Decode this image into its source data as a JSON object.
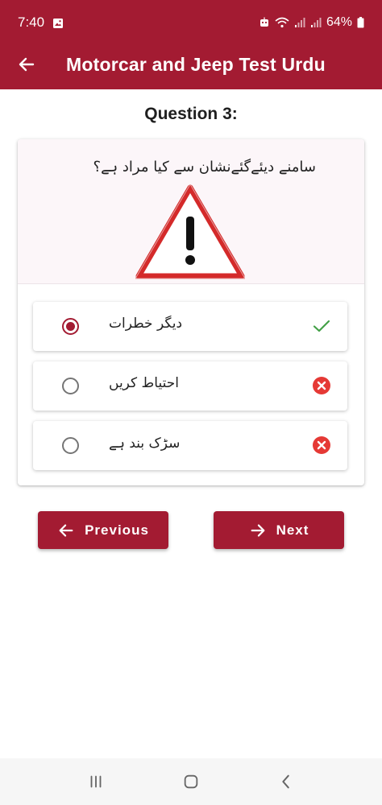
{
  "status_bar": {
    "time": "7:40",
    "battery": "64%",
    "icons": [
      "image-icon",
      "robot-icon",
      "wifi-icon",
      "signal-icon",
      "signal-icon",
      "battery-icon"
    ]
  },
  "app_bar": {
    "title": "Motorcar and Jeep Test Urdu",
    "back_icon": "arrow-left-icon"
  },
  "question": {
    "number_label": "Question 3:",
    "text": "سامنے دیئےگئےنشان سے کیا مراد ہے؟",
    "image": "warning-triangle-sign"
  },
  "options": [
    {
      "label": "دیگر خطرات",
      "selected": true,
      "result": "correct",
      "icon": "check-icon"
    },
    {
      "label": "احتیاط کریں",
      "selected": false,
      "result": "wrong",
      "icon": "close-circle-icon"
    },
    {
      "label": "سڑک بند ہے",
      "selected": false,
      "result": "wrong",
      "icon": "close-circle-icon"
    }
  ],
  "buttons": {
    "previous_label": "Previous",
    "next_label": "Next"
  },
  "colors": {
    "primary": "#a31b32",
    "correct": "#43a047",
    "wrong": "#e53935"
  },
  "nav_bar": {
    "icons": [
      "recent-apps-icon",
      "home-icon",
      "back-icon"
    ]
  }
}
